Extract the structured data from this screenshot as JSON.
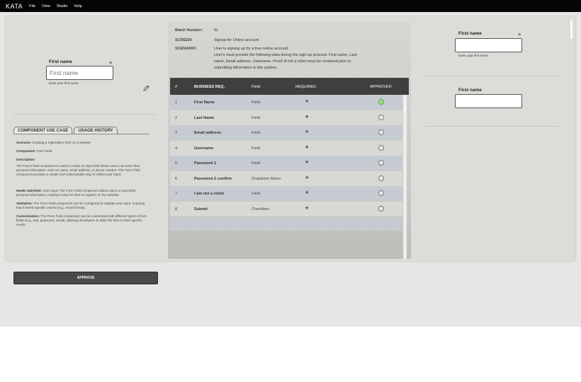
{
  "menubar": {
    "logo": "KATA",
    "items": [
      "File",
      "View",
      "Studio",
      "Help"
    ]
  },
  "preview": {
    "label": "First name",
    "placeholder": "First name",
    "hint": "Enter your first name",
    "required_mark": "⊕"
  },
  "tabs": [
    "COMPONENT USE CASE",
    "USAGE HISTORY"
  ],
  "use_case": {
    "scenario_label": "Scenario:",
    "scenario": "Creating a registration form on a website",
    "component_label": "Component:",
    "component": "Form Field",
    "description_label": "Description:",
    "description": "The Form Field component is used to create an input field where users can enter their personal information, such as name, email address, or phone number. The Form Field component provides a simple and customizable way to collect user input.",
    "needs_label": "Needs Satisfied:",
    "needs": "User Input: The Form Field component allows users to input their personal information, making it easy for them to register on the website.",
    "validation_label": "Validation:",
    "validation": "The Form Field component can be configured to validate user input, ensuring that it meets specific criteria (e.g., email format).",
    "customization_label": "Customization:",
    "customization": "The Form Field component can be customized with different types of form fields (e.g., text, password, email), allowing developers to tailor the form to their specific needs."
  },
  "batch": {
    "number_label": "Batch Number:",
    "number": "01",
    "screen_label": "SCREEN:",
    "screen": "Signup for Online account",
    "scenario_label": "SCENARIO:",
    "scenario_line1": "User is signing up for a free online account.",
    "scenario_line2": "User's must provide the following data during the sign-up process: First name, Last",
    "scenario_line3": "name, Email address, Username. Proof of not a robot must be rendered prior to",
    "scenario_line4": "submitting information to the system."
  },
  "table": {
    "headers": [
      "#",
      "BUSINESS REQ.",
      "Field",
      "REQUIRED",
      "APPROVED"
    ],
    "rows": [
      {
        "n": "1",
        "name": "First Name",
        "field": "Field",
        "req": "★",
        "approved": true
      },
      {
        "n": "2",
        "name": "Last Name",
        "field": "Field",
        "req": "★",
        "approved": false
      },
      {
        "n": "3",
        "name": "Email address",
        "field": "Field",
        "req": "★",
        "approved": false
      },
      {
        "n": "4",
        "name": "Username",
        "field": "Field",
        "req": "★",
        "approved": false
      },
      {
        "n": "5",
        "name": "Password 1",
        "field": "Field",
        "req": "★",
        "approved": false
      },
      {
        "n": "6",
        "name": "Password 2 confirm",
        "field": "Dropdown Menu",
        "req": "★",
        "approved": false
      },
      {
        "n": "7",
        "name": "I am not a robot",
        "field": "Field",
        "req": "★",
        "approved": false
      },
      {
        "n": "8",
        "name": "Submit",
        "field": "Checkbox",
        "req": "★",
        "approved": false
      }
    ]
  },
  "right": {
    "field1_label": "First name",
    "field1_hint": "Enter your first name",
    "field1_mark": "⊕",
    "field2_label": "First name"
  },
  "approve_label": "APPROVE",
  "colors": {
    "menubar": "#050505",
    "approved": "#9ee07f",
    "table_header": "#3f3f3f"
  }
}
